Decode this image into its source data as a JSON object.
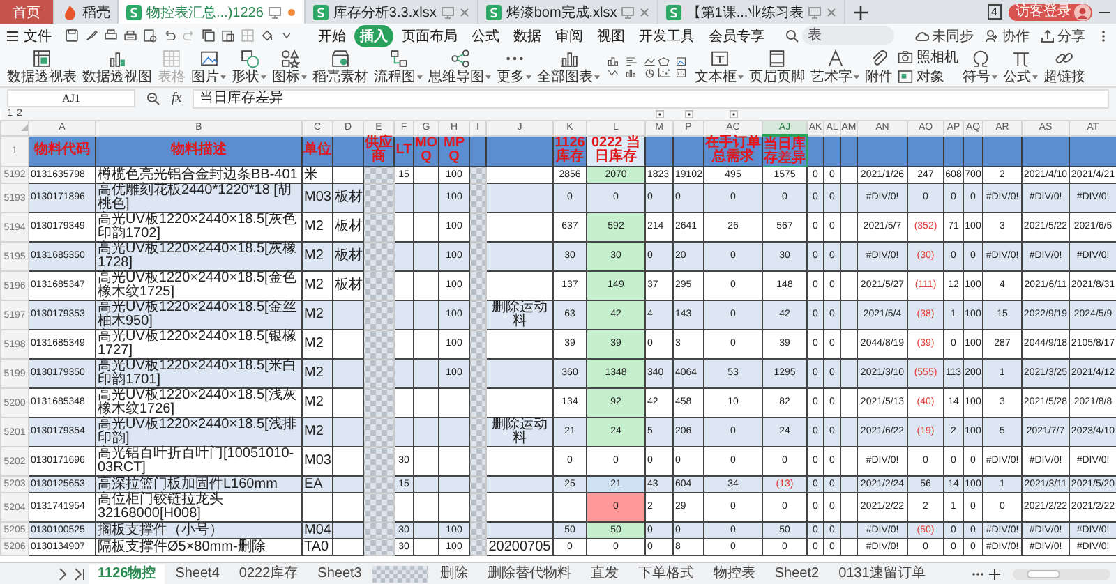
{
  "title_tabs": [
    {
      "label": "首页",
      "kind": "home",
      "selected": false,
      "modified": false
    },
    {
      "label": "稻壳",
      "kind": "app",
      "selected": false,
      "modified": false
    },
    {
      "label": "物控表汇总...)1226",
      "kind": "doc",
      "selected": true,
      "modified": true
    },
    {
      "label": "库存分析3.3.xlsx",
      "kind": "doc",
      "selected": false,
      "modified": false
    },
    {
      "label": "烤漆bom完成.xlsx",
      "kind": "doc",
      "selected": false,
      "modified": false
    },
    {
      "label": "【第1课...业练习表",
      "kind": "doc",
      "selected": false,
      "modified": false
    }
  ],
  "window_count": "4",
  "login_button": "访客登录",
  "menu": {
    "file": "文件",
    "tabs": [
      {
        "label": "开始",
        "selected": false
      },
      {
        "label": "插入",
        "selected": true
      },
      {
        "label": "页面布局",
        "selected": false
      },
      {
        "label": "公式",
        "selected": false
      },
      {
        "label": "数据",
        "selected": false
      },
      {
        "label": "审阅",
        "selected": false
      },
      {
        "label": "视图",
        "selected": false
      },
      {
        "label": "开发工具",
        "selected": false
      },
      {
        "label": "会员专享",
        "selected": false
      }
    ],
    "search": {
      "placeholder": "表"
    },
    "actions": [
      "未同步",
      "协作",
      "分享"
    ]
  },
  "ribbon": [
    {
      "label": "数据透视表",
      "kind": "large",
      "menu": false,
      "disabled": false
    },
    {
      "label": "数据透视图",
      "kind": "large",
      "menu": false,
      "disabled": false
    },
    {
      "label": "表格",
      "kind": "large",
      "menu": false,
      "disabled": true
    },
    {
      "label": "图片",
      "kind": "large",
      "menu": true,
      "disabled": false
    },
    {
      "label": "形状",
      "kind": "large",
      "menu": true,
      "disabled": false
    },
    {
      "label": "图标",
      "kind": "large",
      "menu": true,
      "disabled": false
    },
    {
      "label": "稻壳素材",
      "kind": "large",
      "menu": false,
      "disabled": false
    },
    {
      "label": "流程图",
      "kind": "large",
      "menu": true,
      "disabled": false
    },
    {
      "label": "思维导图",
      "kind": "large",
      "menu": true,
      "disabled": false
    },
    {
      "label": "更多",
      "kind": "large",
      "menu": true,
      "disabled": false
    },
    {
      "label": "全部图表",
      "kind": "chart",
      "menu": true,
      "disabled": false
    },
    {
      "label": "文本框",
      "kind": "large",
      "menu": true,
      "disabled": false
    },
    {
      "label": "页眉页脚",
      "kind": "large",
      "menu": false,
      "disabled": false
    },
    {
      "label": "艺术字",
      "kind": "large",
      "menu": true,
      "disabled": false
    },
    {
      "label": "附件",
      "kind": "large",
      "menu": false,
      "disabled": false
    },
    {
      "label": "照相机",
      "kind": "small",
      "menu": false,
      "disabled": false
    },
    {
      "label": "对象",
      "kind": "small",
      "menu": false,
      "disabled": false
    },
    {
      "label": "符号",
      "kind": "large",
      "menu": true,
      "disabled": false
    },
    {
      "label": "公式",
      "kind": "large",
      "menu": true,
      "disabled": false
    },
    {
      "label": "超链接",
      "kind": "large",
      "menu": false,
      "disabled": false
    }
  ],
  "formula_bar": {
    "cell": "AJ1",
    "fx": "fx",
    "formula": "当日库存差异"
  },
  "outline_levels": [
    "1",
    "2"
  ],
  "sheet": {
    "header_row": "1",
    "columns": [
      {
        "letter": "A",
        "header": "物料代码",
        "selected": false,
        "highlighted": false,
        "pixelated": false
      },
      {
        "letter": "B",
        "header": "物料描述",
        "selected": false,
        "highlighted": false,
        "pixelated": false
      },
      {
        "letter": "C",
        "header": "单位",
        "selected": false,
        "highlighted": false,
        "pixelated": false
      },
      {
        "letter": "D",
        "selected": false,
        "highlighted": false,
        "pixelated": false
      },
      {
        "letter": "E",
        "header": "供应商",
        "selected": false,
        "highlighted": false,
        "pixelated": true
      },
      {
        "letter": "F",
        "header": "LT",
        "selected": false,
        "highlighted": false,
        "pixelated": false
      },
      {
        "letter": "G",
        "header": "MOQ",
        "selected": false,
        "highlighted": false,
        "pixelated": false
      },
      {
        "letter": "H",
        "header": "MPQ",
        "selected": false,
        "highlighted": false,
        "pixelated": false
      },
      {
        "letter": "I",
        "selected": false,
        "highlighted": false,
        "pixelated": true
      },
      {
        "letter": "J",
        "selected": false,
        "highlighted": false,
        "pixelated": false
      },
      {
        "letter": "K",
        "header": "1126库存",
        "selected": false,
        "highlighted": false,
        "pixelated": false
      },
      {
        "letter": "L",
        "header": "0222 当日库存",
        "selected": false,
        "highlighted": true,
        "pixelated": false
      },
      {
        "letter": "M",
        "selected": false,
        "highlighted": false,
        "pixelated": false
      },
      {
        "letter": "P",
        "selected": false,
        "highlighted": false,
        "pixelated": false
      },
      {
        "letter": "AC",
        "header": "在手订单总需求",
        "selected": false,
        "highlighted": false,
        "pixelated": false
      },
      {
        "letter": "AJ",
        "header": "当日库存差异",
        "selected": true,
        "highlighted": false,
        "pixelated": false
      },
      {
        "letter": "AK",
        "selected": false,
        "highlighted": false,
        "pixelated": false
      },
      {
        "letter": "AL",
        "selected": false,
        "highlighted": false,
        "pixelated": false
      },
      {
        "letter": "AM",
        "selected": false,
        "highlighted": false,
        "pixelated": false
      },
      {
        "letter": "AN",
        "selected": false,
        "highlighted": false,
        "pixelated": false
      },
      {
        "letter": "AO",
        "selected": false,
        "highlighted": false,
        "pixelated": false
      },
      {
        "letter": "AP",
        "selected": false,
        "highlighted": false,
        "pixelated": false
      },
      {
        "letter": "AQ",
        "selected": false,
        "highlighted": false,
        "pixelated": false
      },
      {
        "letter": "AR",
        "selected": false,
        "highlighted": false,
        "pixelated": false
      },
      {
        "letter": "AS",
        "selected": false,
        "highlighted": false,
        "pixelated": false
      },
      {
        "letter": "AT",
        "selected": false,
        "highlighted": false,
        "pixelated": false
      }
    ],
    "rows": [
      {
        "num": "5192",
        "color": "#c6efce",
        "cells": [
          "0131635798",
          "樽榄色亮光铝合金封边条BB-401",
          "米",
          null,
          null,
          "15",
          null,
          "100",
          null,
          null,
          "2856",
          "2070",
          "1823",
          "19102",
          "495",
          "1575",
          "0",
          "0",
          null,
          "2021/1/26",
          "247",
          "608",
          "700",
          "2",
          "2021/4/10",
          "2021/4/21"
        ]
      },
      {
        "num": "5193",
        "cells": [
          "0130171896",
          "高优雕刻花板2440*1220*18 [胡桃色]",
          "M03",
          "板材",
          null,
          null,
          null,
          "100",
          null,
          null,
          "0",
          "0",
          "0",
          "0",
          "0",
          "0",
          "0",
          "0",
          null,
          "#DIV/0!",
          "0",
          "0",
          "0",
          "#DIV/0!",
          "#DIV/0!",
          "#DIV/0!"
        ]
      },
      {
        "num": "5194",
        "color": "#c6efce",
        "cells": [
          "0130179349",
          "高光UV板1220×2440×18.5[灰色印韵1702]",
          "M2",
          "板材",
          null,
          null,
          null,
          "100",
          null,
          null,
          "637",
          "592",
          "214",
          "2641",
          "26",
          "567",
          "0",
          "0",
          null,
          "2021/5/7",
          {
            "text": "(352)",
            "red": true
          },
          "71",
          "100",
          "3",
          "2021/5/22",
          "2021/6/5"
        ]
      },
      {
        "num": "5195",
        "color": "#c6efce",
        "cells": [
          "0131685350",
          "高光UV板1220×2440×18.5[灰橡1728]",
          "M2",
          "板材",
          null,
          null,
          null,
          "100",
          null,
          null,
          "30",
          "30",
          "0",
          "20",
          "0",
          "30",
          "0",
          "0",
          null,
          "#DIV/0!",
          {
            "text": "(30)",
            "red": true
          },
          "0",
          "0",
          "#DIV/0!",
          "#DIV/0!",
          "#DIV/0!"
        ]
      },
      {
        "num": "5196",
        "color": "#c6efce",
        "cells": [
          "0131685347",
          "高光UV板1220×2440×18.5[金色橡木纹1725]",
          "M2",
          "板材",
          null,
          null,
          null,
          "100",
          null,
          null,
          "137",
          "149",
          "37",
          "295",
          "0",
          "148",
          "0",
          "0",
          null,
          "2021/5/27",
          {
            "text": "(111)",
            "red": true
          },
          "12",
          "100",
          "4",
          "2021/6/11",
          "2021/8/31"
        ]
      },
      {
        "num": "5197",
        "color": "#c6efce",
        "cells": [
          "0130179353",
          "高光UV板1220×2440×18.5[金丝柚木950]",
          "M2",
          null,
          null,
          null,
          null,
          "100",
          null,
          "删除运动料",
          "63",
          "42",
          "4",
          "143",
          "0",
          "42",
          "0",
          "0",
          null,
          "2021/5/4",
          {
            "text": "(38)",
            "red": true
          },
          "1",
          "100",
          "15",
          "2022/9/19",
          "2024/5/9"
        ]
      },
      {
        "num": "5198",
        "color": "#c6efce",
        "cells": [
          "0131685349",
          "高光UV板1220×2440×18.5[银橡1727]",
          "M2",
          null,
          null,
          null,
          null,
          "100",
          null,
          null,
          "39",
          "39",
          "0",
          "3",
          "0",
          "39",
          "0",
          "0",
          null,
          "2044/8/19",
          {
            "text": "(39)",
            "red": true
          },
          "0",
          "100",
          "287",
          "2044/9/18",
          "2105/8/17"
        ]
      },
      {
        "num": "5199",
        "color": "#c6efce",
        "cells": [
          "0130179350",
          "高光UV板1220×2440×18.5[米白印韵1701]",
          "M2",
          null,
          null,
          null,
          null,
          "100",
          null,
          null,
          "360",
          "1348",
          "340",
          "4064",
          "53",
          "1295",
          "0",
          "0",
          null,
          "2021/3/10",
          {
            "text": "(555)",
            "red": true
          },
          "113",
          "200",
          "1",
          "2021/3/25",
          "2021/4/12"
        ]
      },
      {
        "num": "5200",
        "color": "#c6efce",
        "cells": [
          "0131685348",
          "高光UV板1220×2440×18.5[浅灰橡木纹1726]",
          "M2",
          null,
          null,
          null,
          null,
          null,
          null,
          null,
          "134",
          "92",
          "42",
          "458",
          "10",
          "82",
          "0",
          "0",
          null,
          "2021/5/13",
          {
            "text": "(40)",
            "red": true
          },
          "14",
          "100",
          "3",
          "2021/5/28",
          "2021/8/8"
        ]
      },
      {
        "num": "5201",
        "color": "#c6efce",
        "cells": [
          "0130179354",
          "高光UV板1220×2440×18.5[浅排印韵]",
          "M2",
          null,
          null,
          null,
          null,
          null,
          null,
          "删除运动料",
          "21",
          "24",
          "5",
          "206",
          "0",
          "24",
          "0",
          "0",
          null,
          "2021/6/22",
          {
            "text": "(19)",
            "red": true
          },
          "2",
          "100",
          "5",
          "2021/7/7",
          "2023/4/10"
        ]
      },
      {
        "num": "5202",
        "cells": [
          "0130171696",
          "高光铝百叶折百叶门[10051010-03RCT]",
          "M03",
          null,
          null,
          "30",
          null,
          null,
          null,
          null,
          "0",
          "0",
          "0",
          "0",
          "0",
          "0",
          "0",
          "0",
          null,
          "#DIV/0!",
          "0",
          "0",
          "0",
          "#DIV/0!",
          "#DIV/0!",
          "#DIV/0!"
        ]
      },
      {
        "num": "5203",
        "color": "#cfe2f3",
        "cells": [
          "0130125653",
          "高深拉篮门板加固件L160mm",
          "EA",
          null,
          null,
          "15",
          null,
          null,
          null,
          null,
          "25",
          "21",
          "43",
          "604",
          "34",
          {
            "text": "(13)",
            "red": true
          },
          "0",
          "0",
          null,
          "2021/2/24",
          "56",
          "14",
          "100",
          "1",
          "2021/3/11",
          "2021/5/20"
        ]
      },
      {
        "num": "5204",
        "color": "#ff9999",
        "cells": [
          "0131741954",
          "高位柜门铰链拉龙头32168000[H008]",
          null,
          null,
          null,
          null,
          null,
          null,
          null,
          null,
          null,
          "0",
          "2",
          "29",
          "0",
          "0",
          "0",
          "0",
          null,
          "2021/2/22",
          "2",
          "1",
          "0",
          "0",
          "2021/2/22",
          "2021/2/22"
        ]
      },
      {
        "num": "5205",
        "color": "#c6efce",
        "cells": [
          "0130100525",
          "搁板支撑件（小号）",
          "M04",
          null,
          null,
          "30",
          null,
          "100",
          null,
          null,
          "50",
          "50",
          "0",
          "0",
          "0",
          "50",
          "0",
          "0",
          null,
          "#DIV/0!",
          {
            "text": "(50)",
            "red": true
          },
          "0",
          "0",
          "#DIV/0!",
          "#DIV/0!",
          "#DIV/0!"
        ]
      },
      {
        "num": "5206",
        "cells": [
          "0130134907",
          "隔板支撑件Ø5×80mm-删除",
          "TA0",
          null,
          null,
          "30",
          null,
          "100",
          null,
          "20200705",
          "0",
          "0",
          "0",
          "8",
          "0",
          "0",
          "0",
          "0",
          null,
          "#DIV/0!",
          "0",
          "0",
          "0",
          "#DIV/0!",
          "#DIV/0!",
          "#DIV/0!"
        ]
      }
    ]
  },
  "sheet_tabs": [
    {
      "label": "1126物控",
      "kind": "sheet",
      "selected": true
    },
    {
      "label": "Sheet4",
      "kind": "sheet",
      "selected": false
    },
    {
      "label": "0222库存",
      "kind": "sheet",
      "selected": false
    },
    {
      "label": "Sheet3",
      "kind": "sheet",
      "selected": false
    },
    {
      "kind": "pixelated",
      "selected": false
    },
    {
      "label": "删除",
      "kind": "sheet",
      "selected": false
    },
    {
      "label": "删除替代物料",
      "kind": "sheet",
      "selected": false
    },
    {
      "label": "直发",
      "kind": "sheet",
      "selected": false
    },
    {
      "label": "下单格式",
      "kind": "sheet",
      "selected": false
    },
    {
      "label": "物控表",
      "kind": "sheet",
      "selected": false
    },
    {
      "label": "Sheet2",
      "kind": "sheet",
      "selected": false
    },
    {
      "label": "0131速留订单",
      "kind": "sheet",
      "selected": false
    }
  ]
}
